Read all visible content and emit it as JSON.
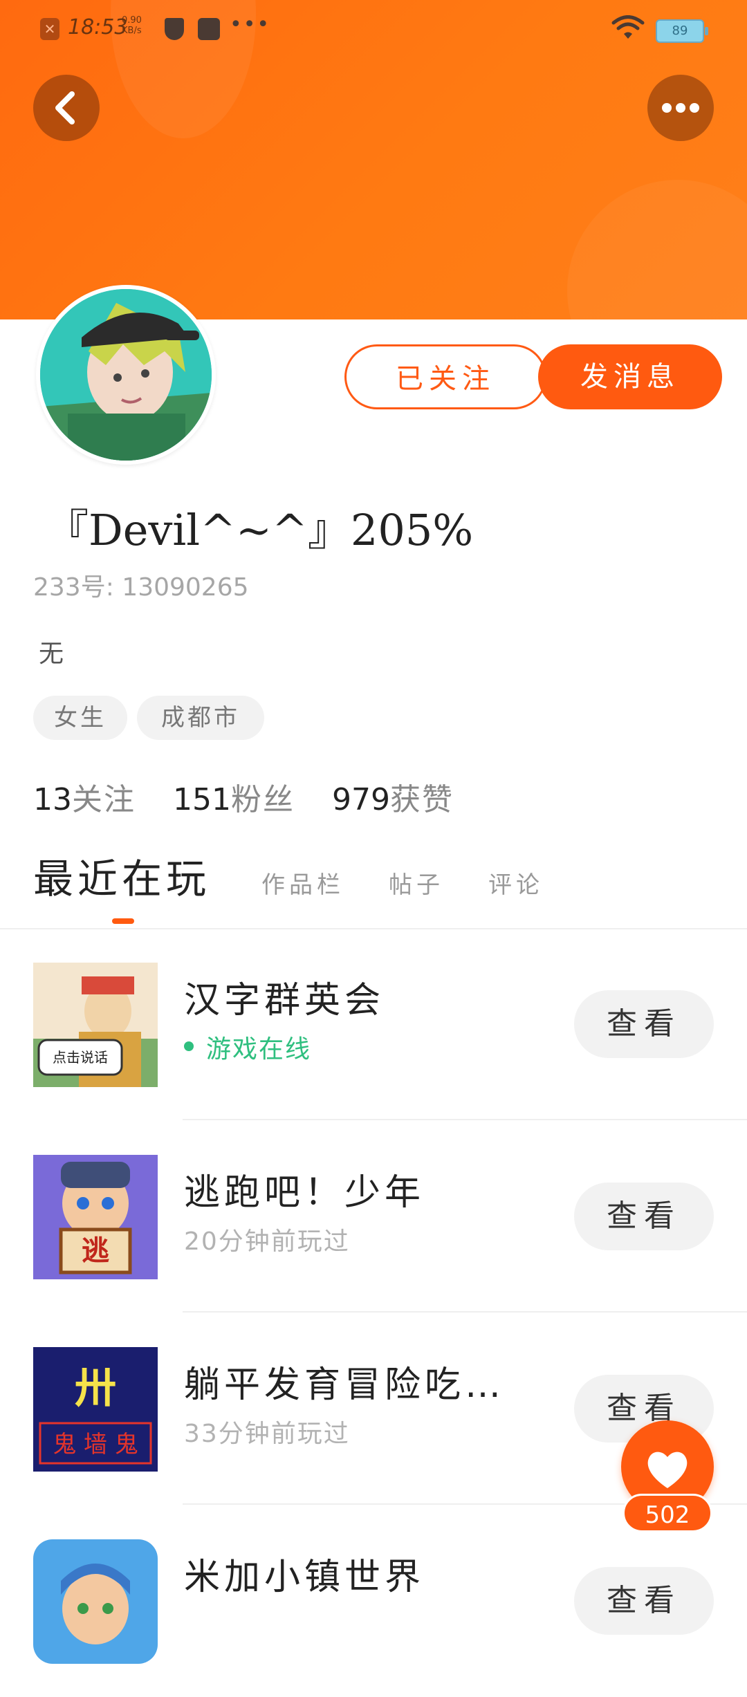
{
  "status_bar": {
    "time": "18:53",
    "net_speed_value": "0.90",
    "net_speed_unit": "KB/s",
    "battery": "89"
  },
  "header": {
    "back_icon": "chevron-left-icon",
    "more_icon": "ellipsis-icon"
  },
  "profile": {
    "follow_label": "已关注",
    "message_label": "发消息",
    "username": "『Devil^~^』205%",
    "uid": "233号: 13090265",
    "bio": "无",
    "tags": [
      "女生",
      "成都市"
    ],
    "stats": {
      "following_count": "13",
      "following_label": "关注",
      "followers_count": "151",
      "followers_label": "粉丝",
      "likes_count": "979",
      "likes_label": "获赞"
    }
  },
  "tabs": [
    "最近在玩",
    "作品栏",
    "帖子",
    "评论"
  ],
  "games": [
    {
      "name": "汉字群英会",
      "status": "游戏在线",
      "online": true,
      "thumb_caption": "点击说话",
      "view_label": "查看"
    },
    {
      "name": "逃跑吧！少年",
      "status": "20分钟前玩过",
      "online": false,
      "thumb_caption": "逃",
      "view_label": "查看"
    },
    {
      "name": "躺平发育冒险吃…",
      "status": "33分钟前玩过",
      "online": false,
      "thumb_caption": "鬼 墙 鬼",
      "view_label": "查看"
    },
    {
      "name": "米加小镇世界",
      "status": "",
      "online": false,
      "thumb_caption": "",
      "view_label": "查看"
    }
  ],
  "like_fab": {
    "icon": "heart-icon",
    "count": "502"
  },
  "colors": {
    "accent": "#ff5a10",
    "header_gradient_start": "#ff6a10",
    "header_gradient_end": "#ff7f1a",
    "online_green": "#2fbf7f"
  }
}
